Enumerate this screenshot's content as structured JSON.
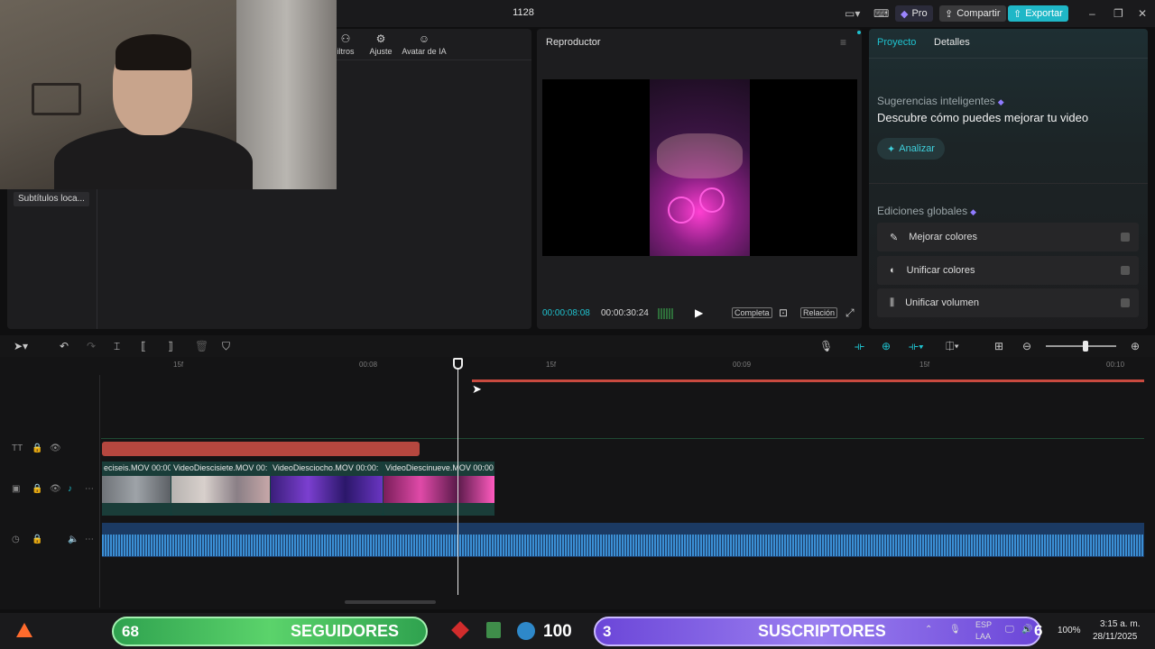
{
  "window": {
    "title": "1128"
  },
  "header": {
    "pro_label": "Pro",
    "share_label": "Compartir",
    "export_label": "Exportar"
  },
  "media_panel": {
    "tools": [
      {
        "label": "iltros",
        "icon": "filters-icon"
      },
      {
        "label": "Ajuste",
        "icon": "adjust-icon"
      },
      {
        "label": "Avatar de IA",
        "icon": "ai-avatar-icon"
      }
    ],
    "category_item": "Subtítulos loca..."
  },
  "player": {
    "title": "Reproductor",
    "current_time": "00:00:08:08",
    "total_time": "00:00:30:24",
    "view_full_label": "Completa",
    "ratio_label": "Relación"
  },
  "right_panel": {
    "tabs": [
      "Proyecto",
      "Detalles"
    ],
    "active_tab": "Proyecto",
    "suggestions_title": "Sugerencias inteligentes",
    "suggestions_heading": "Descubre cómo puedes mejorar tu video",
    "analyze_label": "Analizar",
    "global_edits_title": "Ediciones globales",
    "global_edits": [
      {
        "label": "Mejorar colores",
        "icon": "enhance-colors-icon"
      },
      {
        "label": "Unificar colores",
        "icon": "unify-colors-icon"
      },
      {
        "label": "Unificar volumen",
        "icon": "unify-volume-icon"
      }
    ]
  },
  "timeline": {
    "ruler_labels": [
      "15f",
      "00:08",
      "15f",
      "00:09",
      "15f",
      "00:10"
    ],
    "video_clips": [
      {
        "label": "eciseis.MOV   00:00"
      },
      {
        "label": "VideoDiescisiete.MOV  00:"
      },
      {
        "label": "VideoDiesciocho.MOV   00:00:"
      },
      {
        "label": "VideoDiescinueve.MOV   00:00"
      }
    ]
  },
  "taskbar": {
    "followers_count": "68",
    "followers_label": "SEGUIDORES",
    "badge_number": "100",
    "subscribers_count": "3",
    "subscribers_label": "SUSCRIPTORES",
    "notification_count": "6",
    "battery": "100%",
    "language_top": "ESP",
    "language_bottom": "LAA",
    "time": "3:15 a. m.",
    "date": "28/11/2025"
  },
  "colors": {
    "accent": "#1fc2cf",
    "export_bg": "#1fb7c7",
    "text_clip": "#b5473f",
    "audio_track": "#1b3a63",
    "followers_bg": "#5bd36b",
    "subscribers_bg": "#9b7ff0"
  }
}
